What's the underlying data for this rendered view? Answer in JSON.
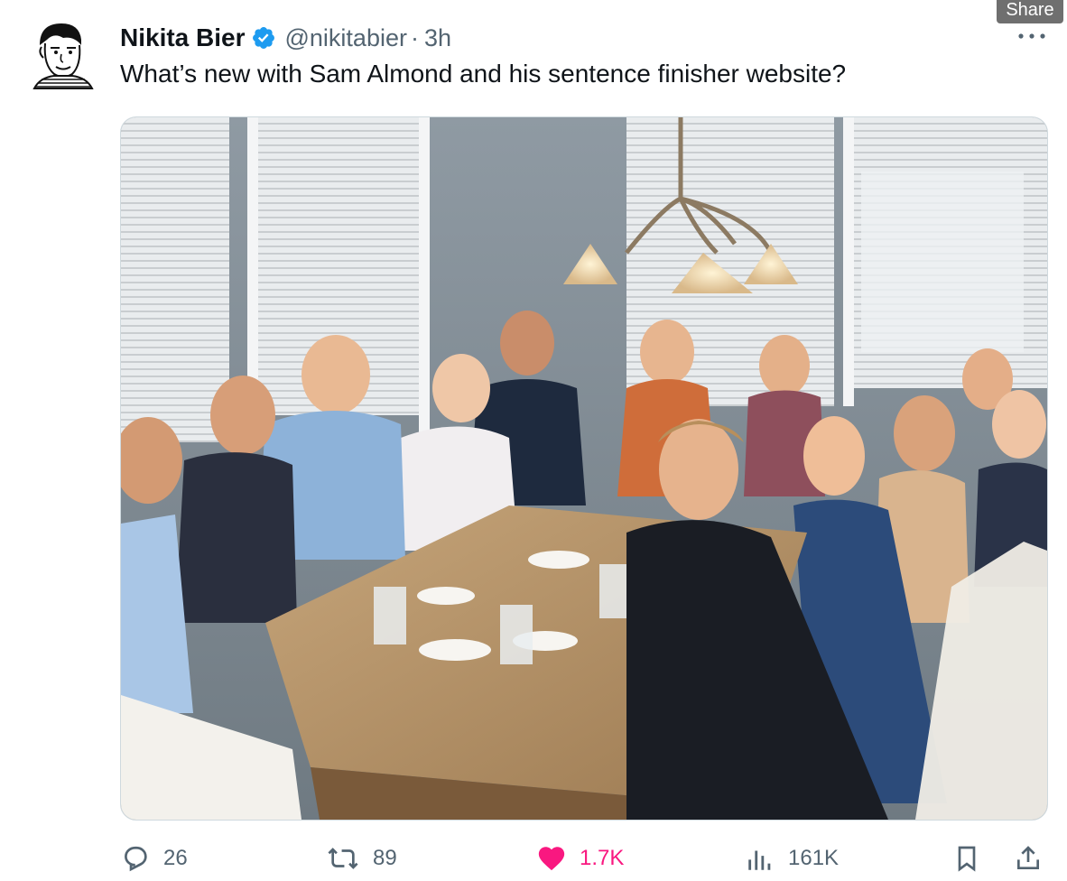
{
  "overlay": {
    "share_label": "Share"
  },
  "author": {
    "name": "Nikita Bier",
    "handle": "@nikitabier",
    "separator": "·",
    "time": "3h",
    "verified": true
  },
  "tweet": {
    "text": "What’s new with Sam Almond and his sentence finisher website?"
  },
  "media": {
    "type": "photo"
  },
  "actions": {
    "replies": "26",
    "reposts": "89",
    "likes": "1.7K",
    "views": "161K",
    "liked": true
  },
  "icons": {
    "more": "more-horizontal-icon",
    "reply": "reply-icon",
    "repost": "repost-icon",
    "like": "heart-icon",
    "views": "views-icon",
    "bookmark": "bookmark-icon",
    "share": "share-icon"
  },
  "colors": {
    "text": "#0f1419",
    "secondary": "#536471",
    "verified": "#1d9bf0",
    "like": "#f91880"
  }
}
